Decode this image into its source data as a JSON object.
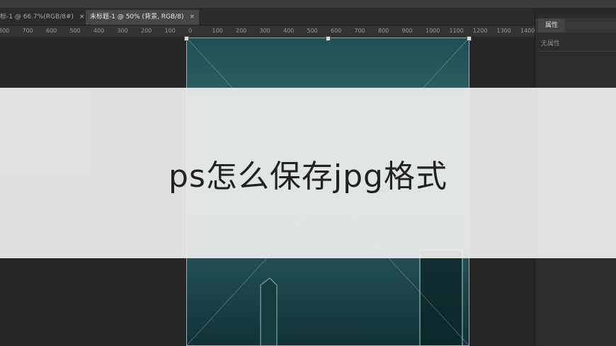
{
  "tabs": [
    {
      "label": "标-1 @ 66.7%(RGB/8#)",
      "close": "×"
    },
    {
      "label": "未标题-1 @ 50% (背景, RGB/8)",
      "close": "×"
    }
  ],
  "ruler_ticks": [
    "800",
    "700",
    "600",
    "500",
    "400",
    "300",
    "200",
    "100",
    "0",
    "100",
    "200",
    "300",
    "400",
    "500",
    "600",
    "700",
    "800",
    "900",
    "1000",
    "1100",
    "1200",
    "1300",
    "1400"
  ],
  "properties_panel": {
    "tab_label": "属性",
    "empty_text": "无属性"
  },
  "overlay_title": "ps怎么保存jpg格式"
}
